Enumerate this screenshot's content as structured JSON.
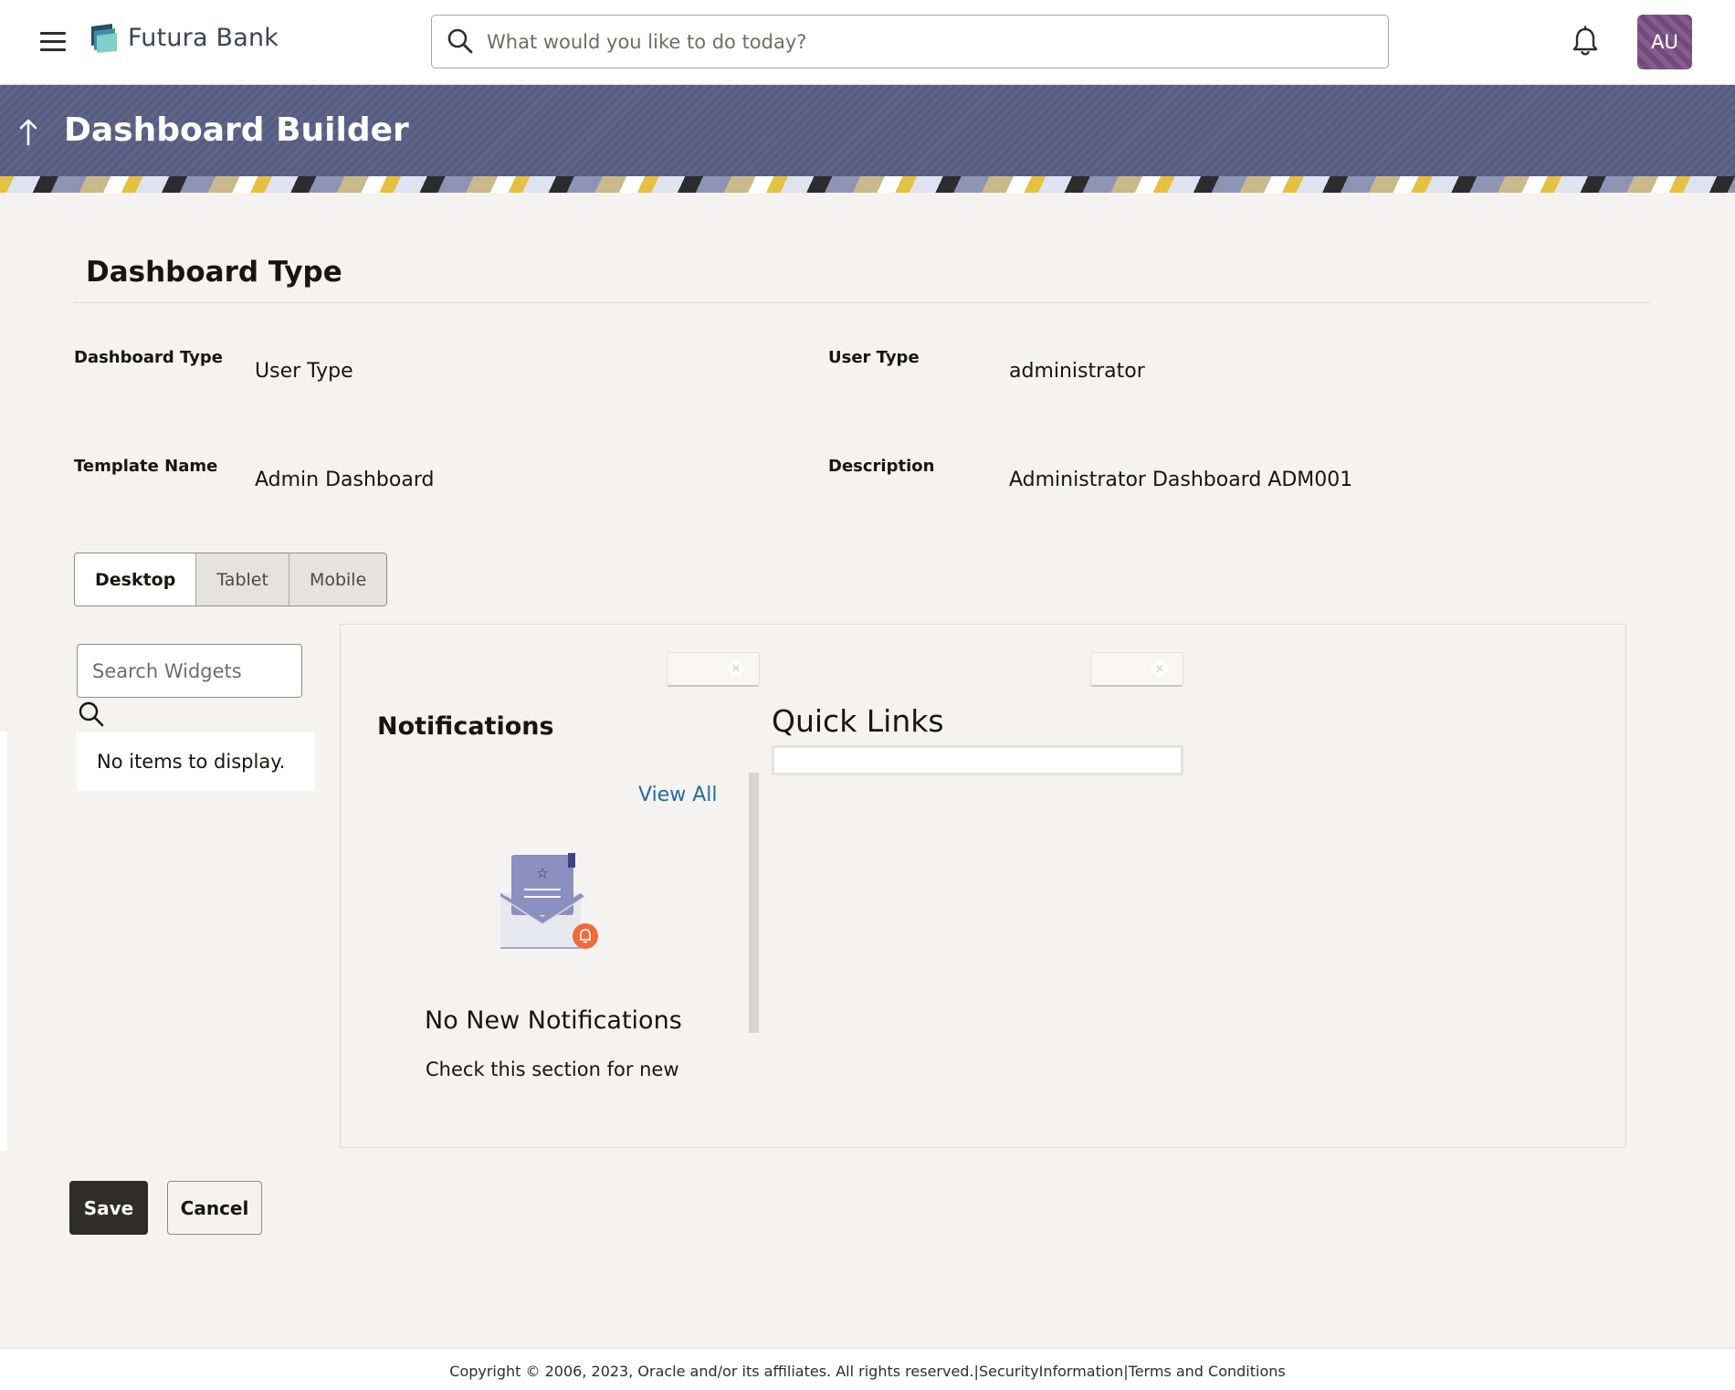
{
  "brand": {
    "name": "Futura Bank"
  },
  "header": {
    "search_placeholder": "What would you like to do today?",
    "avatar_initials": "AU"
  },
  "banner": {
    "title": "Dashboard Builder"
  },
  "section": {
    "title": "Dashboard Type"
  },
  "fields": {
    "dashboard_type": {
      "label": "Dashboard Type",
      "value": "User Type"
    },
    "user_type": {
      "label": "User Type",
      "value": "administrator"
    },
    "template_name": {
      "label": "Template Name",
      "value": "Admin Dashboard"
    },
    "description": {
      "label": "Description",
      "value": "Administrator Dashboard ADM001"
    }
  },
  "devices": {
    "options": [
      "Desktop",
      "Tablet",
      "Mobile"
    ],
    "selected": "Desktop"
  },
  "widgets_panel": {
    "search_placeholder": "Search Widgets",
    "empty_message": "No items to display."
  },
  "notifications_widget": {
    "title": "Notifications",
    "view_all": "View All",
    "empty_title": "No New Notifications",
    "empty_subtitle": "Check this section for new"
  },
  "quick_links_widget": {
    "title": "Quick Links"
  },
  "chip_close_glyph": "×",
  "actions": {
    "save": "Save",
    "cancel": "Cancel"
  },
  "footer": {
    "copyright": "Copyright © 2006, 2023, Oracle and/or its affiliates. All rights reserved.",
    "separator": "|",
    "security": "SecurityInformation",
    "terms": "Terms and Conditions"
  },
  "colors": {
    "banner": "#5a5f85",
    "primary_button": "#2f2c2a",
    "link": "#1e6da0",
    "avatar": "#7a4f83",
    "notification_dot": "#f06a3c",
    "envelope": "#8c8fc0"
  },
  "icons": [
    "menu-icon",
    "bank-logo-icon",
    "search-icon",
    "bell-icon",
    "back-arrow-icon",
    "close-icon",
    "envelope-icon"
  ]
}
